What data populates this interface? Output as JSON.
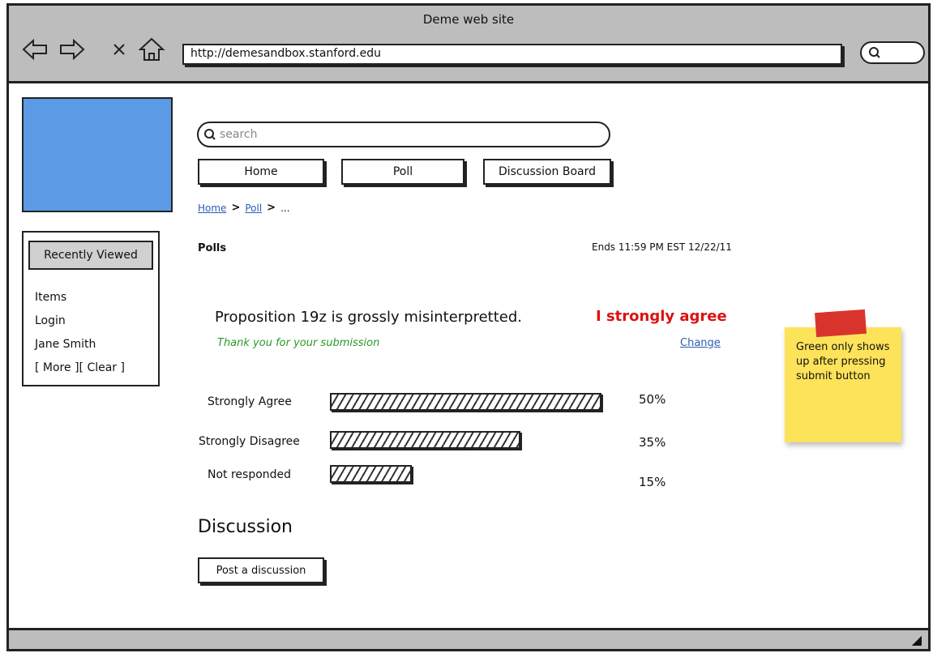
{
  "window": {
    "title": "Deme web site"
  },
  "browser": {
    "url": "http://demesandbox.stanford.edu",
    "nav": {
      "back_icon": "arrow-left-icon",
      "forward_icon": "arrow-right-icon",
      "stop_icon": "close-icon",
      "home_icon": "home-icon"
    }
  },
  "sidebar": {
    "recently_viewed_label": "Recently Viewed",
    "items": [
      "Items",
      "Login",
      "Jane Smith",
      "[ More ][ Clear ]"
    ]
  },
  "search": {
    "placeholder": "search"
  },
  "tabs": [
    "Home",
    "Poll",
    "Discussion Board"
  ],
  "breadcrumb": {
    "items": [
      "Home",
      "Poll"
    ],
    "ellipsis": "..."
  },
  "poll": {
    "title": "Polls",
    "ends": "Ends 11:59 PM EST 12/22/11",
    "proposition": "Proposition 19z is grossly misinterpretted.",
    "user_answer": "I strongly agree",
    "thanks": "Thank you for your submission",
    "change_label": "Change",
    "results": [
      {
        "label": "Strongly Agree",
        "percent": 50,
        "percent_text": "50%"
      },
      {
        "label": "Strongly Disagree",
        "percent": 35,
        "percent_text": "35%"
      },
      {
        "label": "Not responded",
        "percent": 15,
        "percent_text": "15%"
      }
    ]
  },
  "note": {
    "text": "Green only shows up after pressing submit button"
  },
  "discussion": {
    "heading": "Discussion",
    "post_button": "Post a discussion"
  },
  "colors": {
    "logo": "#5b9be6",
    "answer": "#d11111",
    "thanks": "#2a9a2a",
    "link": "#2a5db0",
    "note": "#fde35a",
    "tape": "#d9342b"
  }
}
